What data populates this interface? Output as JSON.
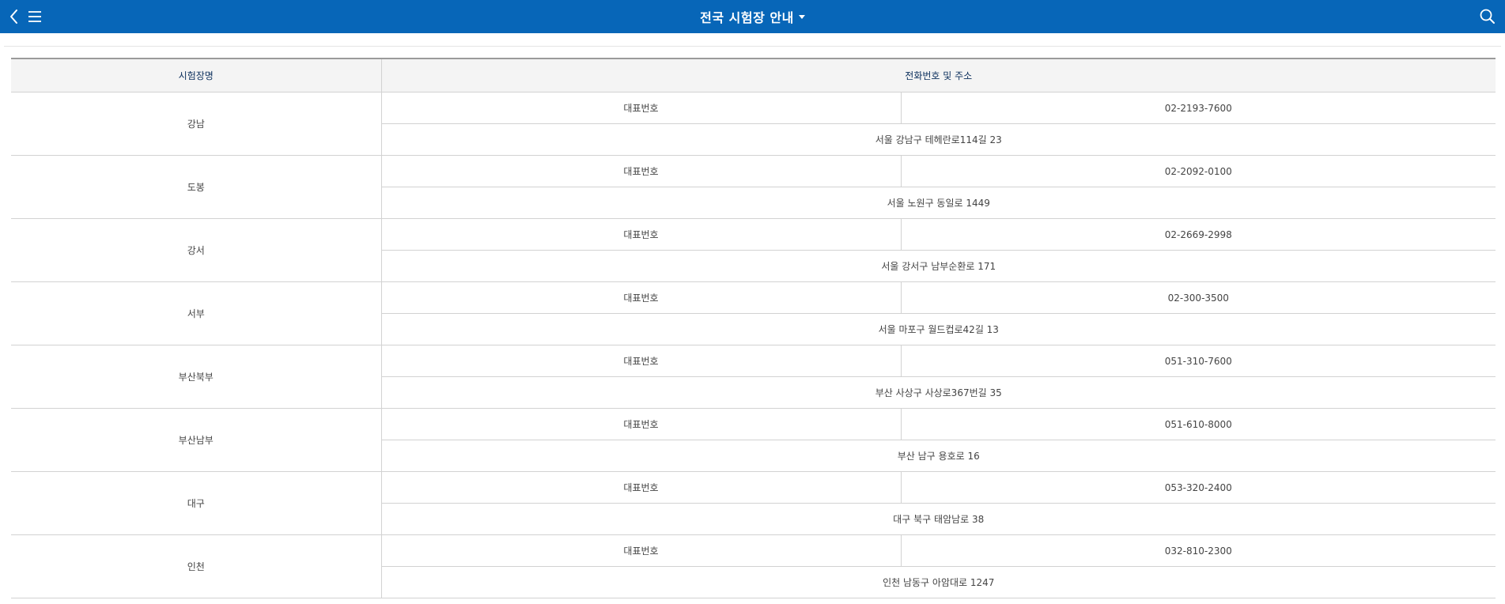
{
  "header": {
    "title": "전국 시험장 안내",
    "icons": {
      "back": "chevron-left-icon",
      "menu": "hamburger-menu-icon",
      "dropdown": "caret-down-icon",
      "search": "search-icon"
    },
    "bar_color": "#0766b8"
  },
  "table": {
    "columns": [
      "시험장명",
      "전화번호 및 주소"
    ],
    "rows": [
      {
        "name": "강남",
        "phone_label": "대표번호",
        "phone": "02-2193-7600",
        "address": "서울 강남구 테헤란로114길 23"
      },
      {
        "name": "도봉",
        "phone_label": "대표번호",
        "phone": "02-2092-0100",
        "address": "서울 노원구 동일로 1449"
      },
      {
        "name": "강서",
        "phone_label": "대표번호",
        "phone": "02-2669-2998",
        "address": "서울 강서구 남부순환로 171"
      },
      {
        "name": "서부",
        "phone_label": "대표번호",
        "phone": "02-300-3500",
        "address": "서울 마포구 월드컵로42길 13"
      },
      {
        "name": "부산북부",
        "phone_label": "대표번호",
        "phone": "051-310-7600",
        "address": "부산 사상구 사상로367번길 35"
      },
      {
        "name": "부산남부",
        "phone_label": "대표번호",
        "phone": "051-610-8000",
        "address": "부산 남구 용호로 16"
      },
      {
        "name": "대구",
        "phone_label": "대표번호",
        "phone": "053-320-2400",
        "address": "대구 북구 태암남로 38"
      },
      {
        "name": "인천",
        "phone_label": "대표번호",
        "phone": "032-810-2300",
        "address": "인천 남동구 아암대로 1247"
      }
    ]
  }
}
